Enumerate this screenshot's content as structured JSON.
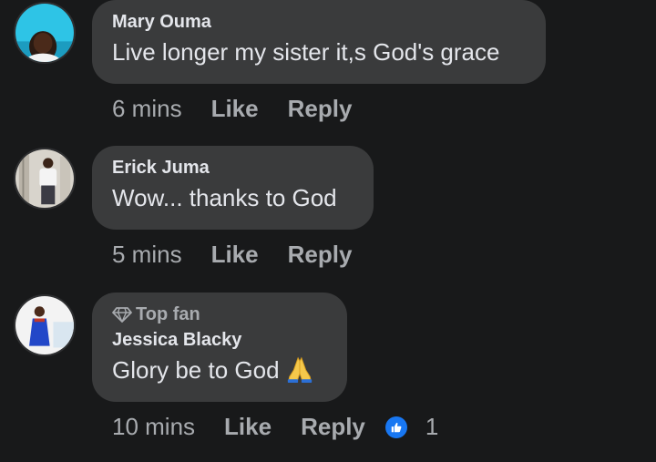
{
  "comments": [
    {
      "author": "Mary Ouma",
      "text": "Live longer my sister it,s God's grace",
      "time": "6 mins",
      "like_label": "Like",
      "reply_label": "Reply"
    },
    {
      "author": "Erick Juma",
      "text": "Wow... thanks to God",
      "time": "5 mins",
      "like_label": "Like",
      "reply_label": "Reply"
    },
    {
      "badge": "Top fan",
      "author": "Jessica Blacky",
      "text": "Glory be to God",
      "emoji": "folded-hands",
      "time": "10 mins",
      "like_label": "Like",
      "reply_label": "Reply",
      "reaction_icon": "thumbs-up-icon",
      "reaction_count": "1"
    }
  ],
  "colors": {
    "background": "#18191a",
    "bubble": "#3a3b3c",
    "primary_text": "#e4e6eb",
    "secondary_text": "#a8abaf",
    "like_blue": "#1877f2"
  }
}
